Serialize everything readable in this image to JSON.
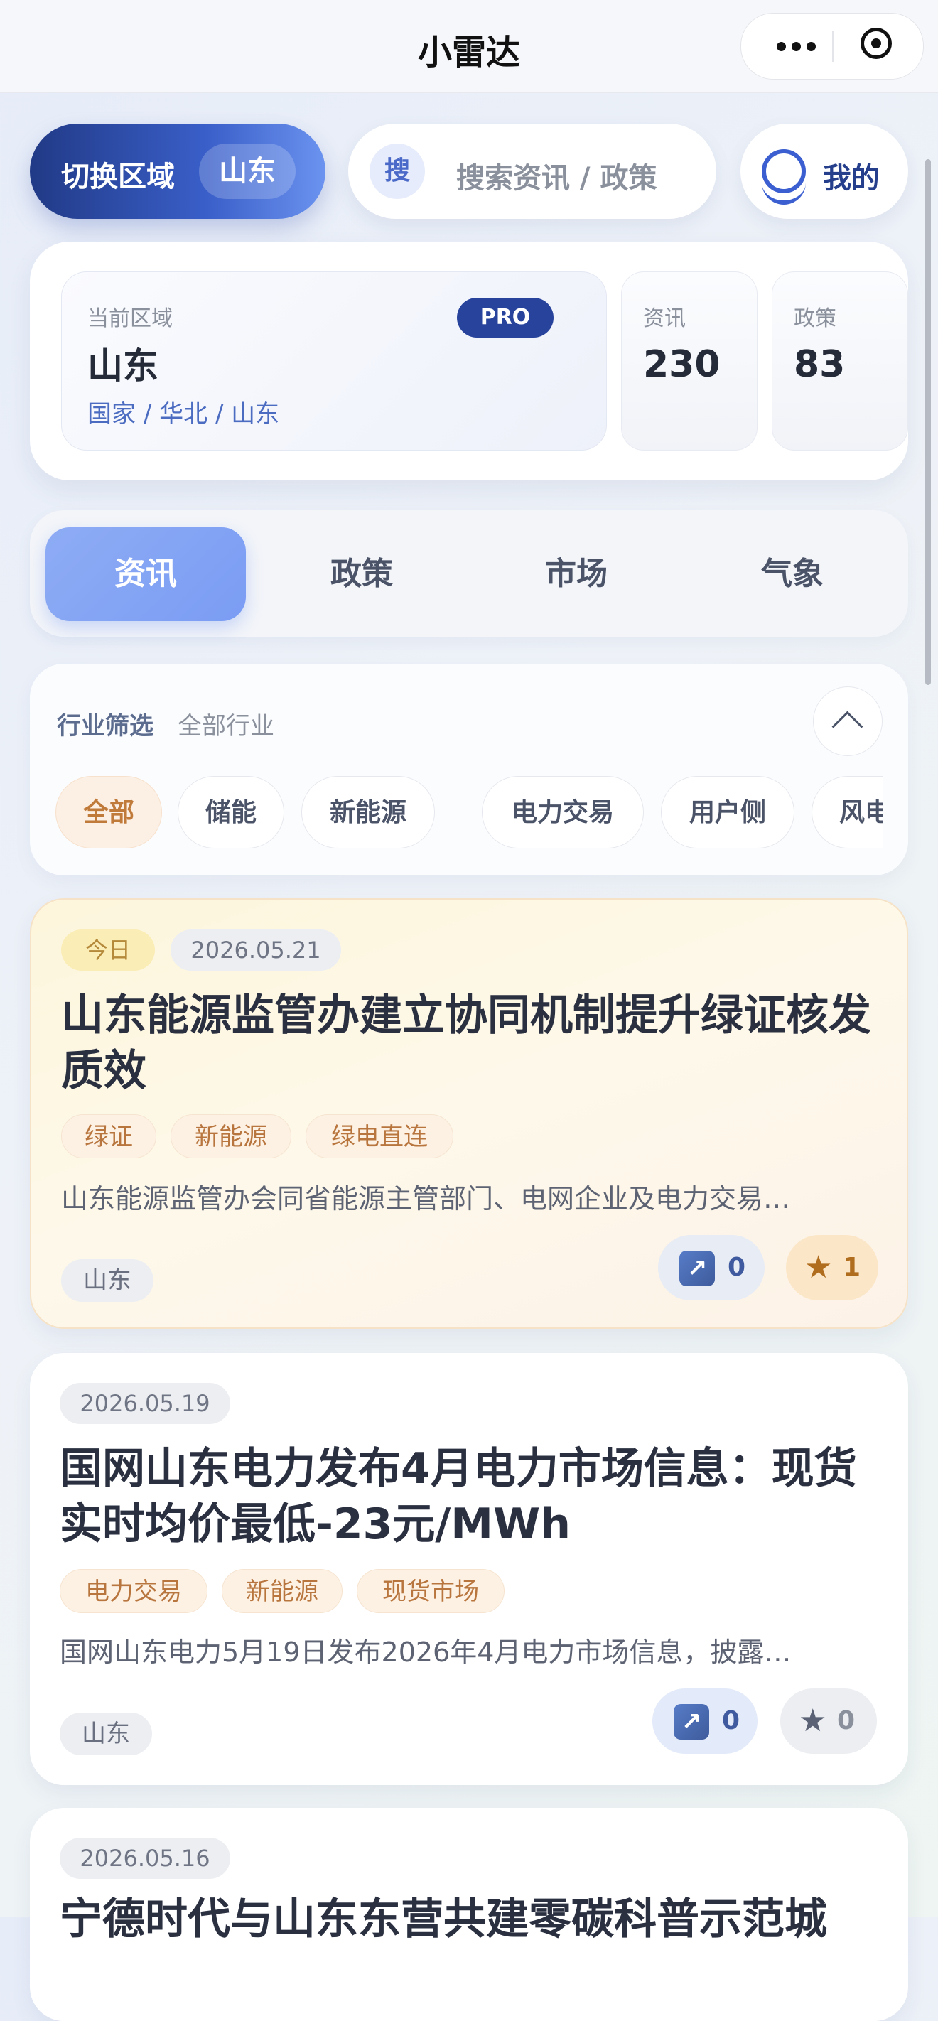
{
  "nav": {
    "title": "小雷达"
  },
  "toolbar": {
    "region_button_label": "切换区域",
    "region_value": "山东",
    "search_icon_text": "搜",
    "search_placeholder": "搜索资讯 / 政策",
    "mine_label": "我的"
  },
  "region_info": {
    "label": "当前区域",
    "badge": "PRO",
    "name": "山东",
    "path": "国家 / 华北 / 山东",
    "stats": [
      {
        "label": "资讯",
        "value": "230"
      },
      {
        "label": "政策",
        "value": "83"
      }
    ]
  },
  "tabs": [
    {
      "label": "资讯",
      "active": true
    },
    {
      "label": "政策",
      "active": false
    },
    {
      "label": "市场",
      "active": false
    },
    {
      "label": "气象",
      "active": false
    }
  ],
  "filter": {
    "title": "行业筛选",
    "subtitle": "全部行业",
    "chips": [
      {
        "label": "全部",
        "active": true
      },
      {
        "label": "储能",
        "active": false
      },
      {
        "label": "新能源",
        "active": false
      },
      {
        "label": "电力交易",
        "active": false
      },
      {
        "label": "用户侧",
        "active": false
      },
      {
        "label": "风电",
        "active": false
      }
    ]
  },
  "news": [
    {
      "today_badge": "今日",
      "date": "2026.05.21",
      "title": "山东能源监管办建立协同机制提升绿证核发质效",
      "tags": [
        "绿证",
        "新能源",
        "绿电直连"
      ],
      "summary": "山东能源监管办会同省能源主管部门、电网企业及电力交易…",
      "region": "山东",
      "share_count": "0",
      "star_count": "1",
      "share_icon": "share-arrow-icon",
      "star_icon": "star-icon"
    },
    {
      "date": "2026.05.19",
      "title": "国网山东电力发布4月电力市场信息：现货实时均价最低-23元/MWh",
      "tags": [
        "电力交易",
        "新能源",
        "现货市场"
      ],
      "summary": "国网山东电力5月19日发布2026年4月电力市场信息，披露…",
      "region": "山东",
      "share_count": "0",
      "star_count": "0",
      "share_icon": "share-arrow-icon",
      "star_icon": "star-icon"
    },
    {
      "date": "2026.05.16",
      "title": "宁德时代与山东东营共建零碳科普示范城"
    }
  ],
  "colors": {
    "primary": "#27439c",
    "accent_blue": "#7a9cf3",
    "featured_bg": "#fdf6dc",
    "tag_orange": "#b8763e"
  }
}
